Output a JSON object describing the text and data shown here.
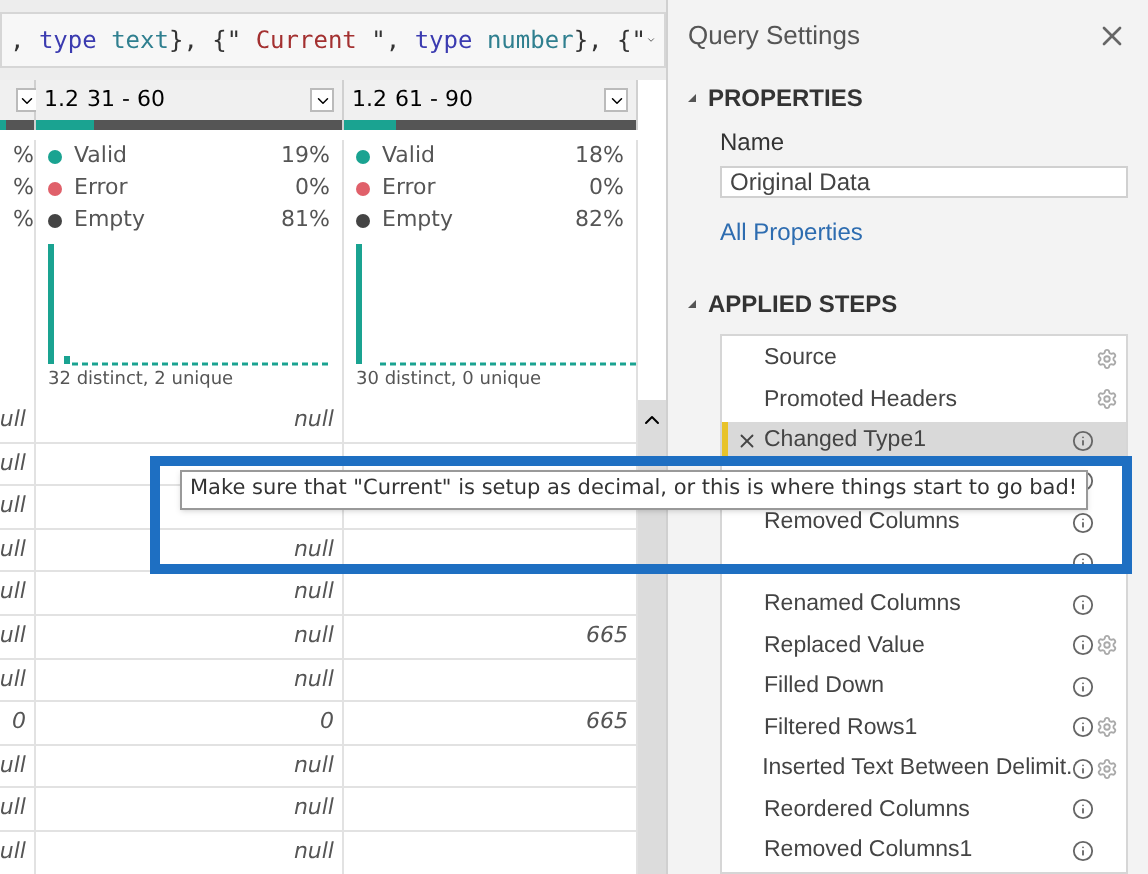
{
  "formula_bar": {
    "tokens": [
      {
        "text": ", ",
        "kind": "punct"
      },
      {
        "text": "type",
        "kind": "keyword"
      },
      {
        "text": " text",
        "kind": "type"
      },
      {
        "text": "}, {\"",
        "kind": "punct"
      },
      {
        "text": " Current ",
        "kind": "string"
      },
      {
        "text": "\", ",
        "kind": "punct"
      },
      {
        "text": "type",
        "kind": "keyword"
      },
      {
        "text": " number",
        "kind": "type"
      },
      {
        "text": "}, {\"",
        "kind": "punct"
      }
    ]
  },
  "columns": [
    {
      "stats": [
        {
          "value": "%"
        },
        {
          "value": "%"
        },
        {
          "value": "%"
        }
      ],
      "quality": {
        "level": 0.2
      }
    },
    {
      "type_label": "1.2",
      "name": "31 - 60",
      "stats": [
        {
          "label": "Valid",
          "value": "19%",
          "color": "#1aa391"
        },
        {
          "label": "Error",
          "value": "0%",
          "color": "#e0606a"
        },
        {
          "label": "Empty",
          "value": "81%",
          "color": "#444444"
        }
      ],
      "quality": {
        "level": 0.19
      },
      "summary": "32 distinct, 2 unique"
    },
    {
      "type_label": "1.2",
      "name": "61 - 90",
      "stats": [
        {
          "label": "Valid",
          "value": "18%",
          "color": "#1aa391"
        },
        {
          "label": "Error",
          "value": "0%",
          "color": "#e0606a"
        },
        {
          "label": "Empty",
          "value": "82%",
          "color": "#444444"
        }
      ],
      "quality": {
        "level": 0.18
      },
      "summary": "30 distinct, 0 unique"
    }
  ],
  "rows": [
    [
      "ull",
      "null",
      ""
    ],
    [
      "ull",
      "",
      ""
    ],
    [
      "ull",
      "",
      ""
    ],
    [
      "ull",
      "null",
      ""
    ],
    [
      "ull",
      "null",
      ""
    ],
    [
      "ull",
      "null",
      "665"
    ],
    [
      "ull",
      "null",
      ""
    ],
    [
      "0",
      "0",
      "665"
    ],
    [
      "ull",
      "null",
      ""
    ],
    [
      "ull",
      "null",
      ""
    ],
    [
      "ull",
      "null",
      ""
    ]
  ],
  "tooltip": "Make sure that \"Current\" is setup as decimal, or this is where things start to go bad!",
  "query_settings": {
    "title": "Query Settings",
    "properties_heading": "PROPERTIES",
    "name_label": "Name",
    "name_value": "Original Data",
    "all_properties_link": "All Properties",
    "steps_heading": "APPLIED STEPS",
    "steps": [
      {
        "label": "Source",
        "selected": false,
        "info": false,
        "gear": true
      },
      {
        "label": "Promoted Headers",
        "selected": false,
        "info": false,
        "gear": true
      },
      {
        "label": "Changed Type1",
        "selected": true,
        "info": true,
        "gear": false
      },
      {
        "selected": false,
        "info": true,
        "gear": false
      },
      {
        "label": "Removed Columns",
        "selected": false,
        "info": true,
        "gear": false
      },
      {
        "selected": false,
        "info": true,
        "gear": false
      },
      {
        "label": "Renamed Columns",
        "selected": false,
        "info": true,
        "gear": false
      },
      {
        "label": "Replaced Value",
        "selected": false,
        "info": true,
        "gear": true
      },
      {
        "label": "Filled Down",
        "selected": false,
        "info": true,
        "gear": false
      },
      {
        "label": "Filtered Rows1",
        "selected": false,
        "info": true,
        "gear": true
      },
      {
        "label": "Inserted Text Between Delimit.",
        "selected": false,
        "info": true,
        "gear": true
      },
      {
        "label": "Reordered Columns",
        "selected": false,
        "info": true,
        "gear": false
      },
      {
        "label": "Removed Columns1",
        "selected": false,
        "info": true,
        "gear": false
      }
    ]
  }
}
